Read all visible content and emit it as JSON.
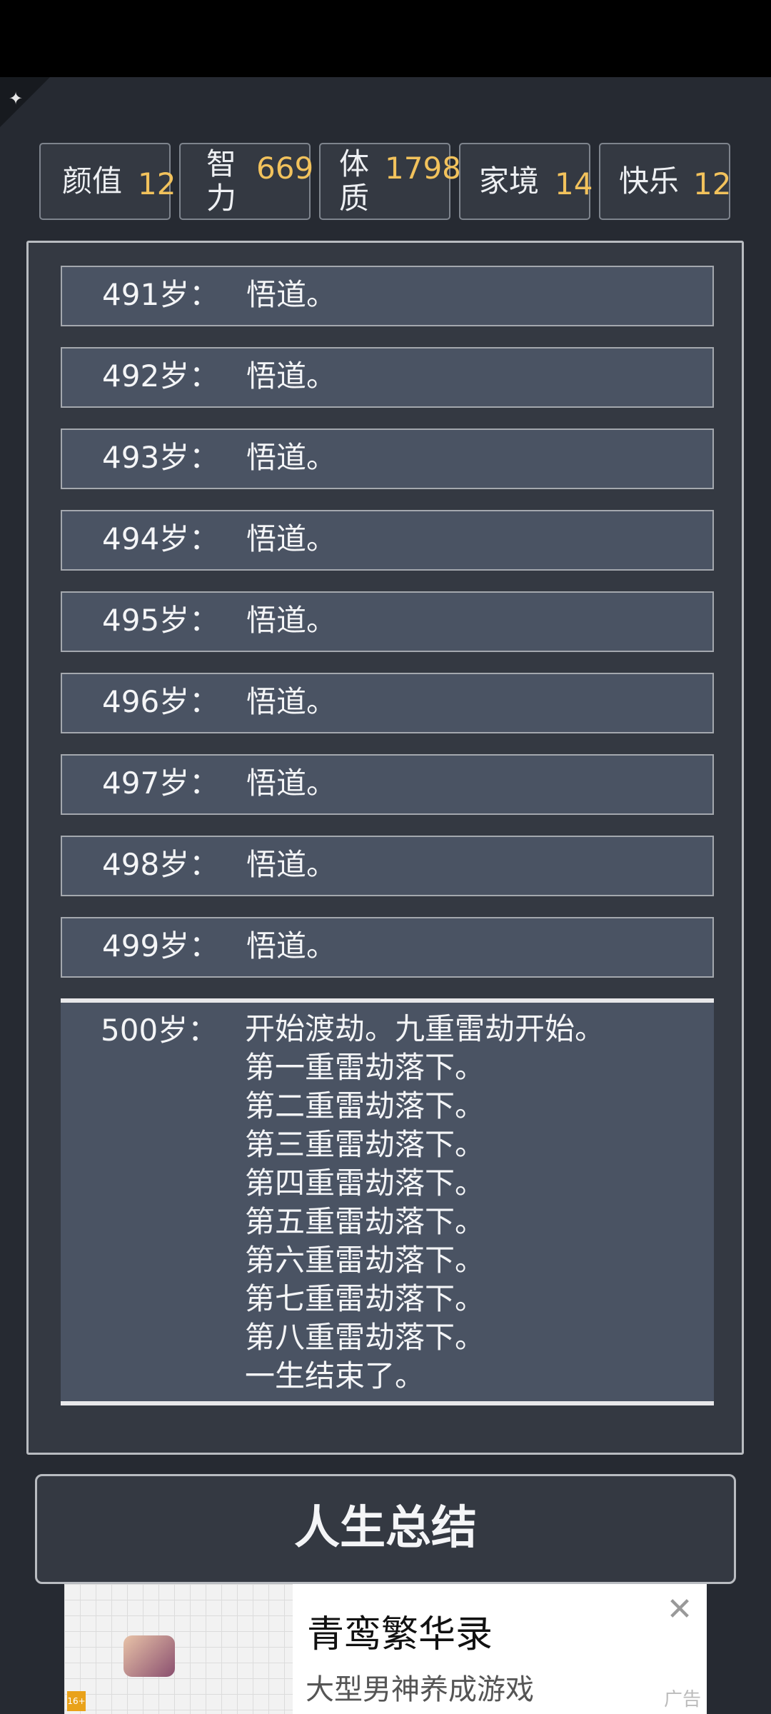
{
  "stats": [
    {
      "label": "颜值",
      "value": "12"
    },
    {
      "label": "智力",
      "value": "669"
    },
    {
      "label": "体质",
      "value": "1798"
    },
    {
      "label": "家境",
      "value": "14"
    },
    {
      "label": "快乐",
      "value": "12"
    }
  ],
  "log": {
    "entries": [
      {
        "age": "491岁：",
        "event": "悟道。"
      },
      {
        "age": "492岁：",
        "event": "悟道。"
      },
      {
        "age": "493岁：",
        "event": "悟道。"
      },
      {
        "age": "494岁：",
        "event": "悟道。"
      },
      {
        "age": "495岁：",
        "event": "悟道。"
      },
      {
        "age": "496岁：",
        "event": "悟道。"
      },
      {
        "age": "497岁：",
        "event": "悟道。"
      },
      {
        "age": "498岁：",
        "event": "悟道。"
      },
      {
        "age": "499岁：",
        "event": "悟道。"
      }
    ],
    "final": {
      "age": "500岁：",
      "lines": [
        "开始渡劫。九重雷劫开始。",
        "第一重雷劫落下。",
        "第二重雷劫落下。",
        "第三重雷劫落下。",
        "第四重雷劫落下。",
        "第五重雷劫落下。",
        "第六重雷劫落下。",
        "第七重雷劫落下。",
        "第八重雷劫落下。",
        "一生结束了。"
      ]
    }
  },
  "summary_button": "人生总结",
  "ad": {
    "title": "青鸾繁华录",
    "subtitle": "大型男神养成游戏",
    "badge": "广告",
    "rating": "16+",
    "close_icon": "close-icon"
  },
  "colors": {
    "background": "#262a32",
    "panel": "#343942",
    "entry": "#4a5363",
    "stat_value": "#f2c25c"
  }
}
